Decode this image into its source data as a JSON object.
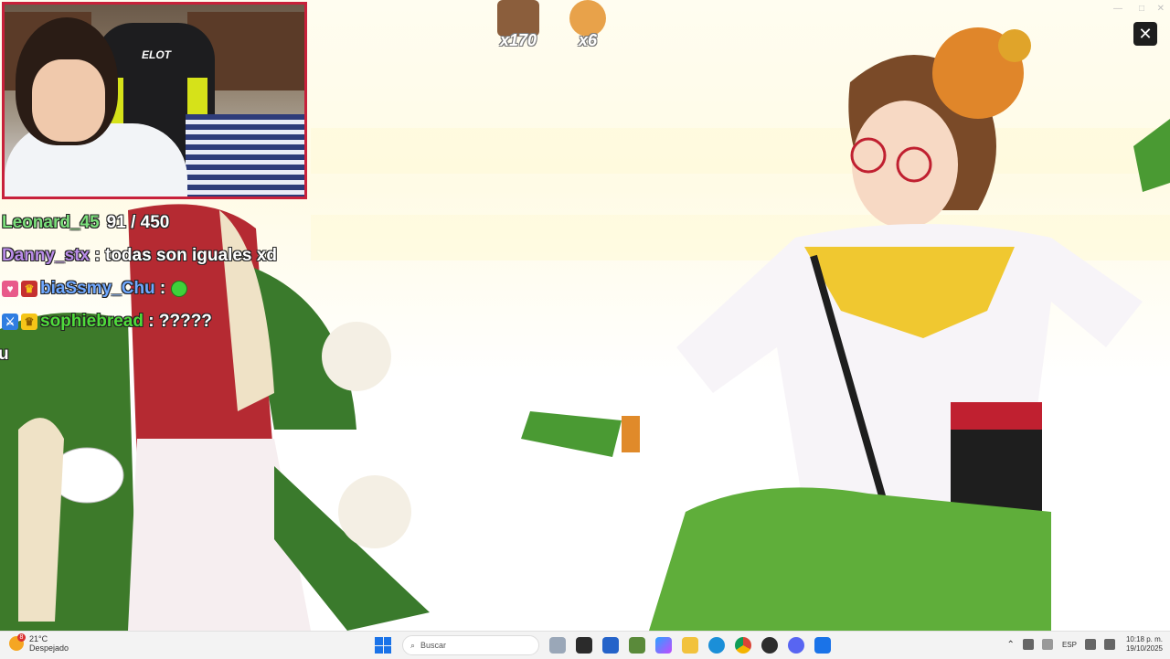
{
  "window": {
    "close_label": "✕",
    "controls": [
      "—",
      "□",
      "✕"
    ]
  },
  "webcam": {
    "chair_brand": "ELOT"
  },
  "chat": {
    "messages": [
      {
        "user": "Leonard_45",
        "user_color": "#7be07b",
        "text": "91 / 450",
        "badges": []
      },
      {
        "user": "Danny_stx",
        "user_color": "#b98ce8",
        "text": "todas son iguales xd",
        "badges": []
      },
      {
        "user": "biaSsmy_Chu",
        "user_color": "#6fa8ff",
        "text": "",
        "badges": [
          "heart",
          "crown"
        ],
        "emote": true
      },
      {
        "user": "sophiebread",
        "user_color": "#4fdc3b",
        "text": "?????",
        "badges": [
          "sword",
          "crown"
        ]
      },
      {
        "user": "",
        "user_color": "#ffffff",
        "text": "u",
        "badges": []
      }
    ]
  },
  "combos": [
    {
      "count": "x170"
    },
    {
      "count": "x6"
    }
  ],
  "taskbar": {
    "weather_temp": "21°C",
    "weather_desc": "Despejado",
    "weather_badge": "8",
    "search_placeholder": "Buscar",
    "language": "ESP",
    "time": "10:18 p. m.",
    "date": "19/10/2025",
    "apps": [
      "widgets-icon",
      "file-explorer-icon",
      "store-icon",
      "minecraft-icon",
      "copilot-icon",
      "folder-icon",
      "edge-icon",
      "chrome-icon",
      "obs-icon",
      "discord-icon",
      "app-icon"
    ]
  },
  "colors": {
    "webcam_border": "#c8213b",
    "accent": "#1a73e8"
  }
}
